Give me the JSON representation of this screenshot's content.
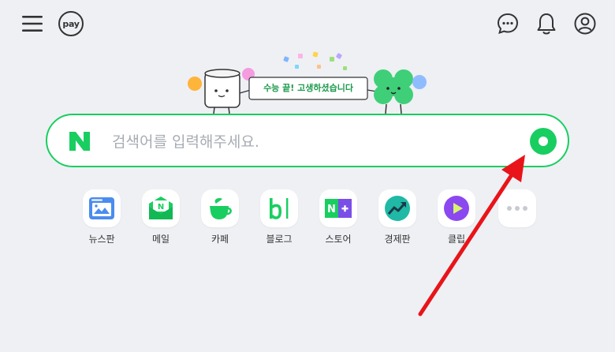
{
  "header": {
    "pay_label": "pay"
  },
  "banner": {
    "text": "수능 끝! 고생하셨습니다"
  },
  "search": {
    "placeholder": "검색어를 입력해주세요."
  },
  "services": [
    {
      "label": "뉴스판"
    },
    {
      "label": "메일"
    },
    {
      "label": "카페"
    },
    {
      "label": "블로그"
    },
    {
      "label": "스토어"
    },
    {
      "label": "경제판"
    },
    {
      "label": "클립"
    }
  ],
  "colors": {
    "brand_green": "#19ce60",
    "annotation_arrow": "#e8141a",
    "background": "#eef0f4"
  }
}
